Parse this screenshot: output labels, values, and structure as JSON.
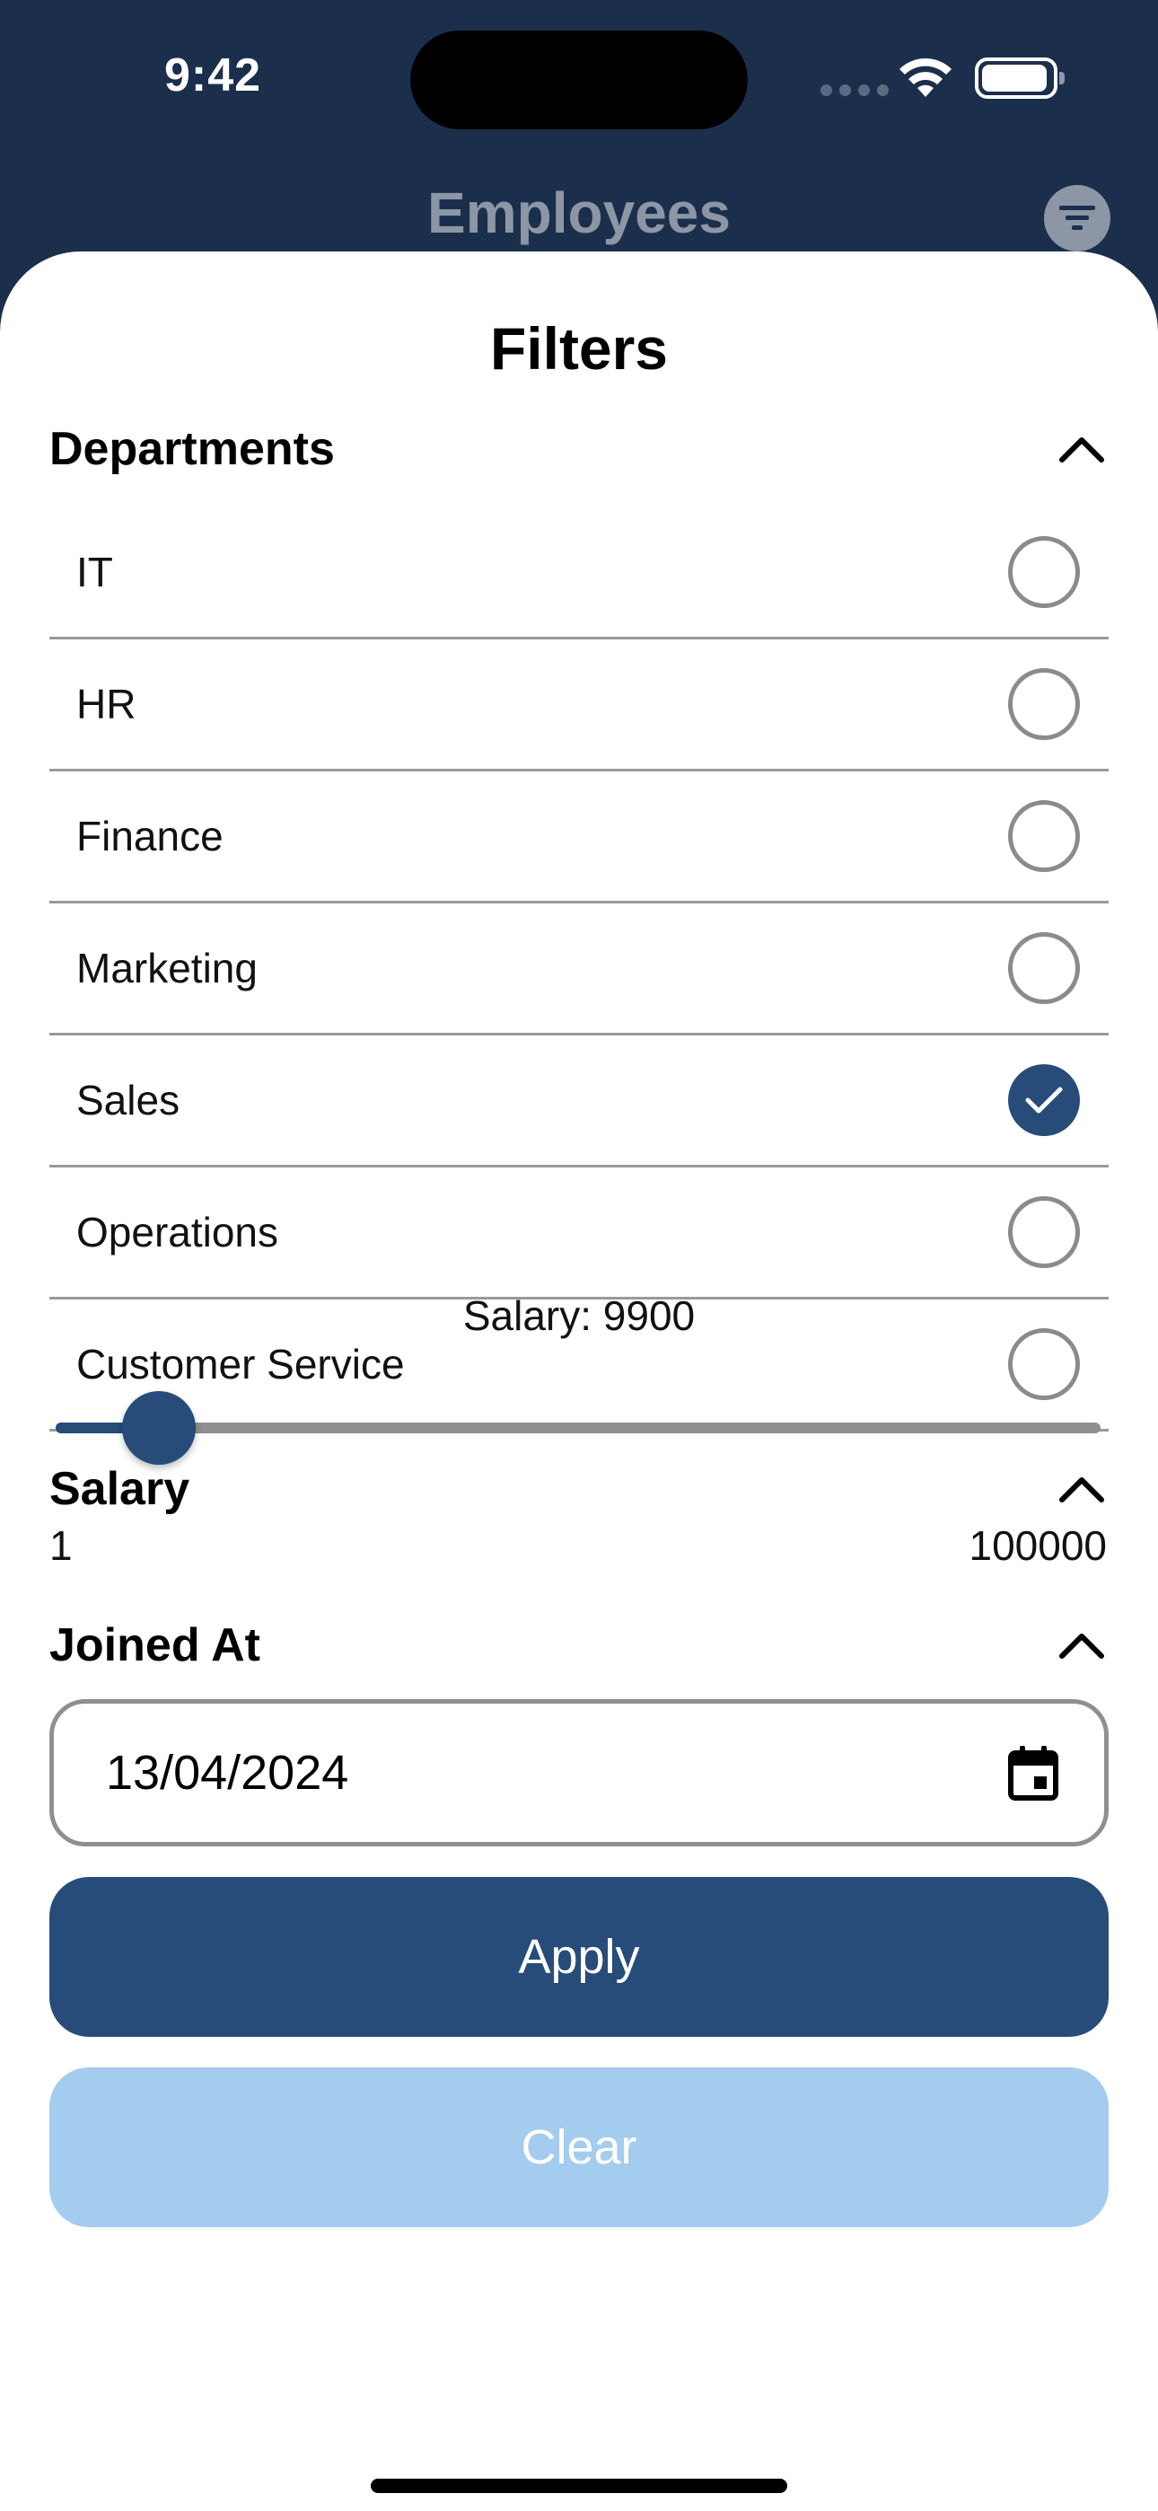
{
  "status_bar": {
    "time": "9:42"
  },
  "header": {
    "title": "Employees",
    "filter_icon": "filter-icon"
  },
  "sheet": {
    "title": "Filters"
  },
  "departments": {
    "label": "Departments",
    "expanded": true,
    "items": [
      {
        "label": "IT",
        "checked": false
      },
      {
        "label": "HR",
        "checked": false
      },
      {
        "label": "Finance",
        "checked": false
      },
      {
        "label": "Marketing",
        "checked": false
      },
      {
        "label": "Sales",
        "checked": true
      },
      {
        "label": "Operations",
        "checked": false
      },
      {
        "label": "Customer Service",
        "checked": false
      }
    ]
  },
  "salary": {
    "label": "Salary",
    "expanded": true,
    "value_text": "Salary: 9900",
    "value": 9900,
    "min": "1",
    "max": "100000",
    "min_value": 1,
    "max_value": 100000
  },
  "joined": {
    "label": "Joined At",
    "expanded": true,
    "date_value": "13/04/2024",
    "icon": "calendar-icon"
  },
  "buttons": {
    "apply": "Apply",
    "clear": "Clear"
  },
  "colors": {
    "accent": "#274c79",
    "header_bg": "#1b2f4d",
    "clear_bg": "#a4ccee",
    "muted": "#8c96a5"
  }
}
